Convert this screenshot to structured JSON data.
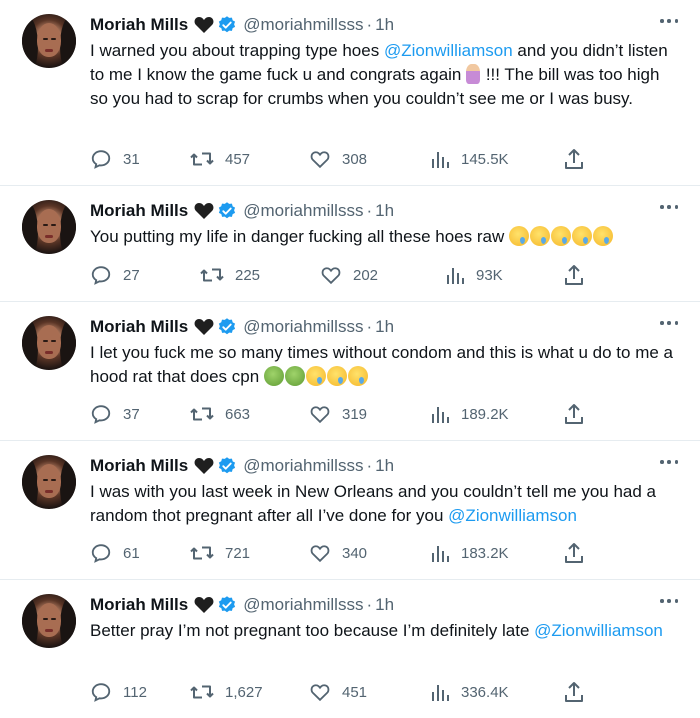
{
  "author": {
    "name": "Moriah Mills",
    "handle": "@moriahmillsss",
    "separator": "·",
    "time": "1h"
  },
  "tweets": [
    {
      "text_segments": [
        "I warned you about trapping type hoes ",
        "@Zionwilliamson",
        " and you didn’t listen to me I know the game fuck u and congrats again ",
        " !!! The bill was too high so you had to scrap for crumbs when you couldn’t see me or I was busy."
      ],
      "emojis": [
        "person-icon"
      ],
      "replies": "31",
      "retweets": "457",
      "likes": "308",
      "views": "145.5K"
    },
    {
      "text_segments": [
        "You putting my life in danger fucking all these hoes raw "
      ],
      "emojis": [
        "drooling-face-icon",
        "drooling-face-icon",
        "drooling-face-icon",
        "drooling-face-icon",
        "drooling-face-icon"
      ],
      "replies": "27",
      "retweets": "225",
      "likes": "202",
      "views": "93K"
    },
    {
      "text_segments": [
        "I let you fuck me so many times without condom and this is what u do to me a hood rat that does cpn "
      ],
      "emojis": [
        "nauseated-face-icon",
        "nauseated-face-icon",
        "drooling-face-icon",
        "drooling-face-icon",
        "drooling-face-icon"
      ],
      "replies": "37",
      "retweets": "663",
      "likes": "319",
      "views": "189.2K"
    },
    {
      "text_segments": [
        "I was with you last week in New Orleans and you couldn’t tell me you had a random thot pregnant after all I’ve done for you ",
        "@Zionwilliamson"
      ],
      "emojis": [],
      "replies": "61",
      "retweets": "721",
      "likes": "340",
      "views": "183.2K"
    },
    {
      "text_segments": [
        "Better pray I’m not pregnant too because I’m definitely late ",
        "@Zionwilliamson"
      ],
      "emojis": [],
      "replies": "112",
      "retweets": "1,627",
      "likes": "451",
      "views": "336.4K"
    }
  ],
  "colors": {
    "text": "#0f1419",
    "secondary": "#536471",
    "link": "#1d9bf0",
    "verified": "#1d9bf0",
    "divider": "#e6ecf0"
  }
}
